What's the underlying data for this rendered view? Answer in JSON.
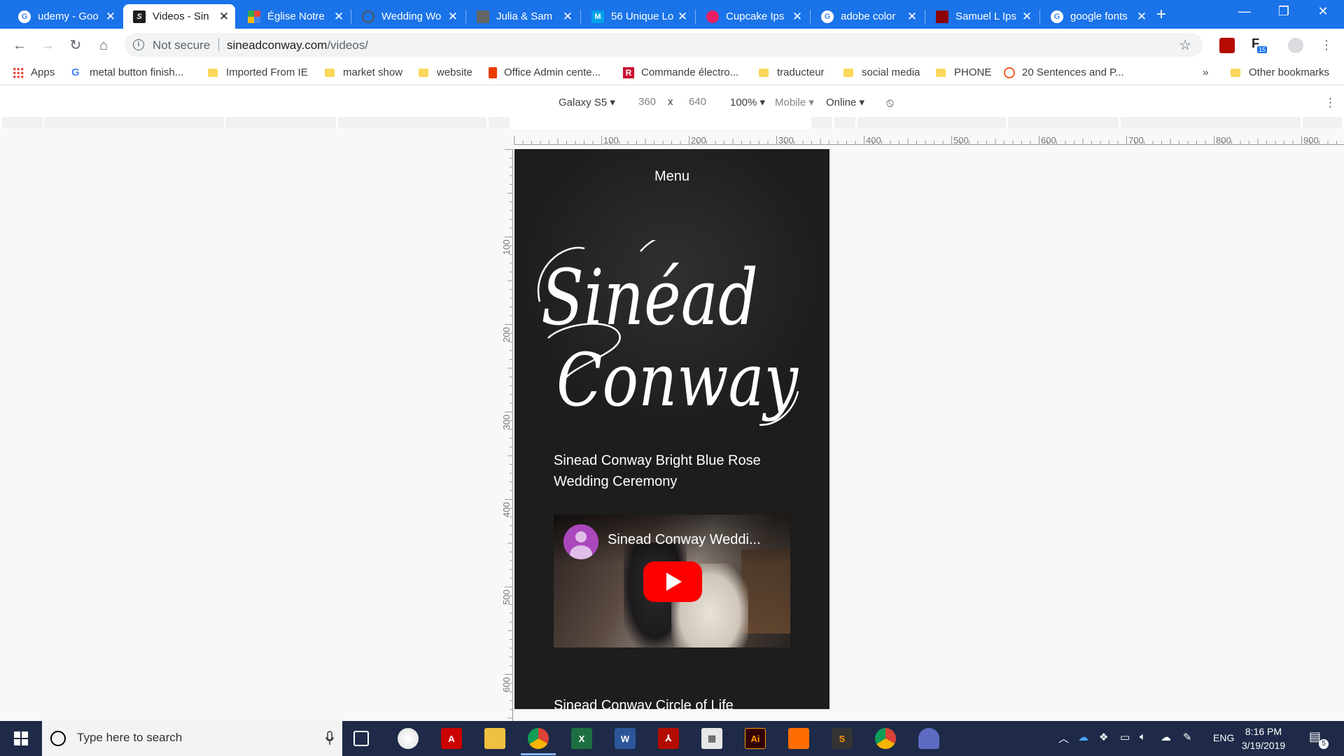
{
  "browser": {
    "tabs": [
      {
        "title": "udemy - Goo",
        "favicon": "google-icon",
        "color": "#ffffff"
      },
      {
        "title": "Videos - Sin",
        "favicon": "site-icon",
        "color": "#1d1d1d",
        "active": true
      },
      {
        "title": "Église Notre",
        "favicon": "church-icon",
        "color": "#e8453c"
      },
      {
        "title": "Wedding Wo",
        "favicon": "ring-icon",
        "color": "#555555"
      },
      {
        "title": "Julia & Sam",
        "favicon": "box-icon",
        "color": "#666666"
      },
      {
        "title": "56 Unique Lo",
        "favicon": "m-icon",
        "color": "#00a2e8"
      },
      {
        "title": "Cupcake Ips",
        "favicon": "cupcake-icon",
        "color": "#e91e63"
      },
      {
        "title": "adobe color",
        "favicon": "google-icon",
        "color": "#ffffff"
      },
      {
        "title": "Samuel L Ips",
        "favicon": "photo-icon",
        "color": "#8b0000"
      },
      {
        "title": "google fonts",
        "favicon": "google-icon",
        "color": "#ffffff"
      }
    ],
    "address": {
      "security": "Not secure",
      "host": "sineadconway.com",
      "path": "/videos/"
    },
    "bookmarks": [
      {
        "label": "Apps",
        "icon": "apps-grid-icon"
      },
      {
        "label": "metal button finish...",
        "icon": "google-icon"
      },
      {
        "label": "Imported From IE",
        "icon": "folder-icon"
      },
      {
        "label": "market show",
        "icon": "folder-icon"
      },
      {
        "label": "website",
        "icon": "folder-icon"
      },
      {
        "label": "Office Admin cente...",
        "icon": "office-icon"
      },
      {
        "label": "Commande électro...",
        "icon": "r-icon"
      },
      {
        "label": "traducteur",
        "icon": "folder-icon"
      },
      {
        "label": "social media",
        "icon": "folder-icon"
      },
      {
        "label": "PHONE",
        "icon": "folder-icon"
      },
      {
        "label": "20 Sentences and P...",
        "icon": "ring-orange-icon"
      }
    ],
    "bookmarks_overflow": "»",
    "other_bookmarks": "Other bookmarks",
    "extension_badge": "15"
  },
  "devtools": {
    "device": "Galaxy S5",
    "width": "360",
    "times": "x",
    "height": "640",
    "zoom": "100%",
    "mode": "Mobile",
    "network": "Online",
    "ruler_h": [
      "100",
      "200",
      "300",
      "400",
      "500",
      "600",
      "700",
      "800",
      "900"
    ],
    "ruler_v": [
      "100",
      "200",
      "300",
      "400",
      "500",
      "600"
    ]
  },
  "page": {
    "menu": "Menu",
    "logo_line1": "Sinéad",
    "logo_line2": "Conway",
    "video1_title": "Sinead Conway Bright Blue Rose Wedding Ceremony",
    "video1_player_title": "Sinead Conway Weddi...",
    "video2_title": "Sinead Conway Circle of Life"
  },
  "taskbar": {
    "search_placeholder": "Type here to search",
    "language": "ENG",
    "time": "8:16 PM",
    "date": "3/19/2019",
    "notification_count": "5"
  }
}
